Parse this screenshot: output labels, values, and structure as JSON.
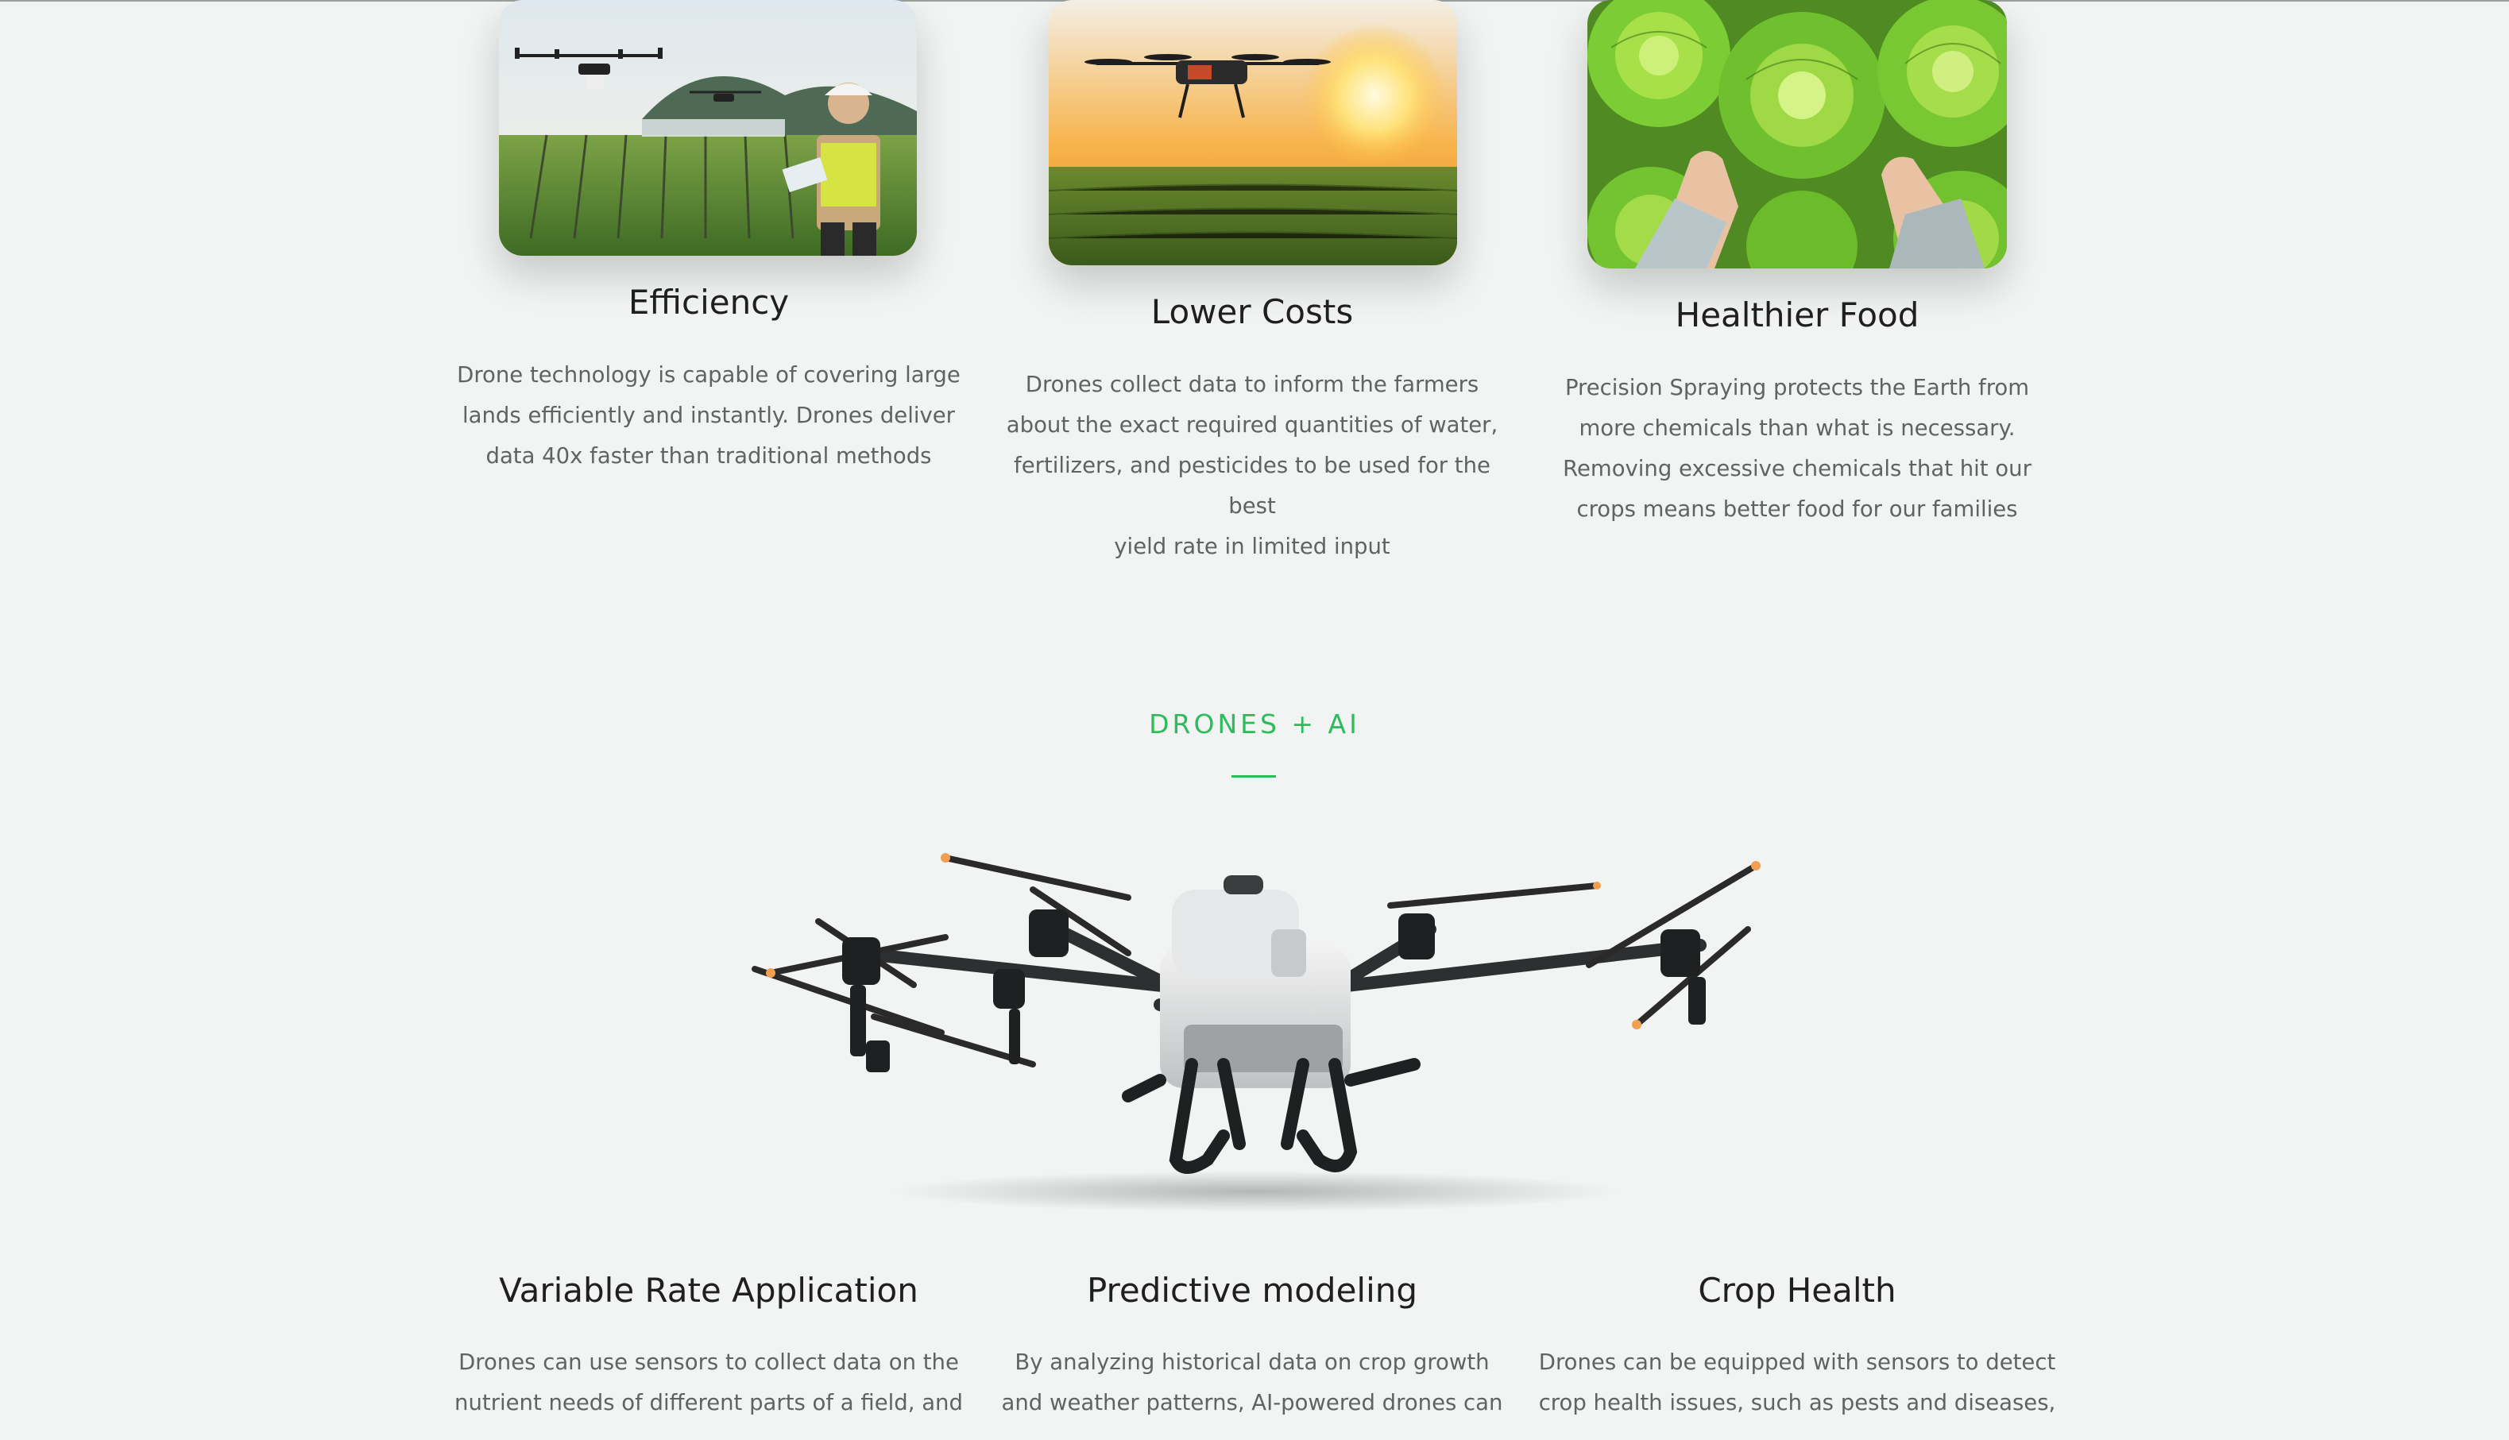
{
  "features": [
    {
      "title": "Efficiency",
      "description_lines": [
        "Drone technology is capable of covering large",
        "lands efficiently and instantly. Drones deliver",
        "data 40x faster than traditional methods"
      ],
      "image": "drone-field-operator-photo"
    },
    {
      "title": "Lower Costs",
      "description_lines": [
        "Drones collect data to inform the farmers",
        "about the exact required quantities of water,",
        "fertilizers, and pesticides to be used for the best",
        "yield rate in limited input"
      ],
      "image": "drone-sunset-cornfield-photo"
    },
    {
      "title": "Healthier Food",
      "description_lines": [
        "Precision Spraying protects the Earth from",
        "more chemicals than what is necessary.",
        "Removing excessive chemicals that hit our",
        "crops means better food for our families"
      ],
      "image": "lettuce-hands-photo"
    }
  ],
  "ai_section": {
    "eyebrow": "DRONES + AI",
    "accent_color": "#2dbb5c",
    "hero_image": "agricultural-spray-drone",
    "items": [
      {
        "title": "Variable Rate Application",
        "description_lines": [
          "Drones can use sensors to collect data on the",
          "nutrient needs of different parts of a field, and"
        ]
      },
      {
        "title": "Predictive modeling",
        "description_lines": [
          "By analyzing historical data on crop growth",
          "and weather patterns, AI-powered drones can"
        ]
      },
      {
        "title": "Crop Health",
        "description_lines": [
          "Drones can be equipped with sensors to detect",
          "crop health issues, such as pests and diseases,"
        ]
      }
    ]
  }
}
